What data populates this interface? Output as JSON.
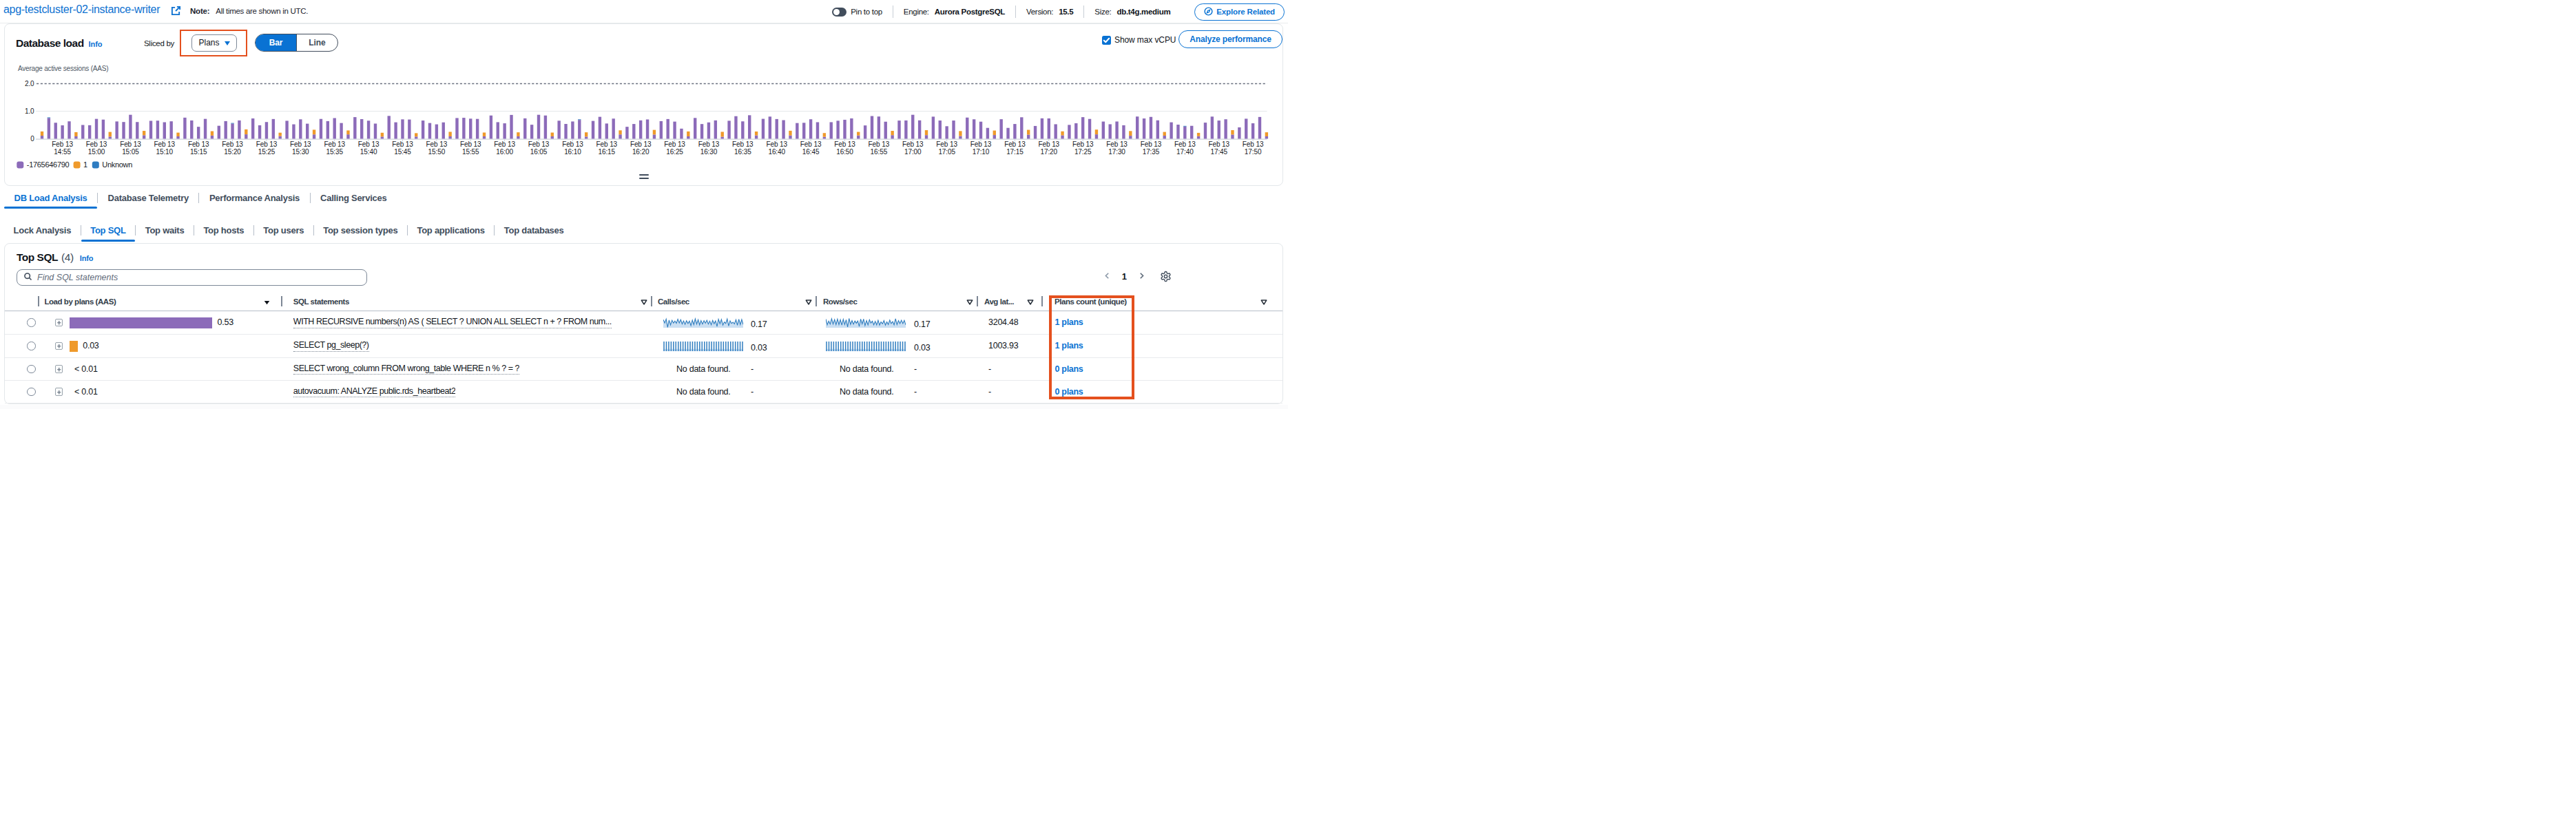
{
  "header": {
    "title": "apg-testcluster-02-instance-writer",
    "note_label": "Note:",
    "note_text": "All times are shown in UTC.",
    "pin_label": "Pin to top",
    "engine_label": "Engine:",
    "engine_value": "Aurora PostgreSQL",
    "version_label": "Version:",
    "version_value": "15.5",
    "size_label": "Size:",
    "size_value": "db.t4g.medium",
    "explore_button": "Explore Related"
  },
  "chart_section": {
    "title": "Database load",
    "info_label": "Info",
    "sliced_by_label": "Sliced by",
    "slice_value": "Plans",
    "bar_toggle": "Bar",
    "line_toggle": "Line",
    "show_max_vcpu_label": "Show max vCPU",
    "show_max_vcpu_checked": true,
    "analyze_button": "Analyze performance",
    "handle": "drag-resize"
  },
  "chart_data": {
    "type": "bar",
    "stacked": true,
    "title": "Average active sessions (AAS)",
    "ylabel": "Average active sessions (AAS)",
    "ylim": [
      0,
      2.0
    ],
    "y_ticks": [
      0,
      1.0,
      2.0
    ],
    "max_vcpu_line": 2.0,
    "x_start_time": "Feb 13 14:52",
    "x_interval_minutes": 1,
    "series": [
      {
        "name": "-1765646790",
        "color": "#8c6bb9",
        "key": "purple"
      },
      {
        "name": "1",
        "color": "#ef9a2b",
        "key": "orange"
      },
      {
        "name": "Unknown",
        "color": "#2e7cc1",
        "key": "blue"
      }
    ],
    "bars": [
      [
        0.111,
        0.154,
        0
      ],
      [
        0.754,
        0,
        0.022
      ],
      [
        0.581,
        0,
        0
      ],
      [
        0.487,
        0,
        0
      ],
      [
        0.632,
        0,
        0
      ],
      [
        0.087,
        0.151,
        0
      ],
      [
        0.5,
        0,
        0
      ],
      [
        0.491,
        0,
        0
      ],
      [
        0.721,
        0,
        0
      ],
      [
        0.695,
        0,
        0
      ],
      [
        0.078,
        0.169,
        0
      ],
      [
        0.628,
        0,
        0
      ],
      [
        0.608,
        0,
        0
      ],
      [
        0.87,
        0,
        0
      ],
      [
        0.607,
        0,
        0
      ],
      [
        0.129,
        0.157,
        0
      ],
      [
        0.651,
        0,
        0
      ],
      [
        0.657,
        0,
        0
      ],
      [
        0.6,
        0,
        0
      ],
      [
        0.633,
        0,
        0
      ],
      [
        0.087,
        0.135,
        0
      ],
      [
        0.766,
        0,
        0
      ],
      [
        0.664,
        0,
        0
      ],
      [
        0.434,
        0,
        0
      ],
      [
        0.721,
        0,
        0
      ],
      [
        0.117,
        0.158,
        0
      ],
      [
        0.471,
        0,
        0
      ],
      [
        0.64,
        0,
        0
      ],
      [
        0.55,
        0,
        0.022
      ],
      [
        0.665,
        0,
        0
      ],
      [
        0.16,
        0.18,
        0
      ],
      [
        0.737,
        0,
        0
      ],
      [
        0.488,
        0,
        0
      ],
      [
        0.607,
        0,
        0
      ],
      [
        0.716,
        0,
        0
      ],
      [
        0.096,
        0.124,
        0
      ],
      [
        0.652,
        0,
        0
      ],
      [
        0.524,
        0,
        0
      ],
      [
        0.705,
        0,
        0
      ],
      [
        0.547,
        0,
        0
      ],
      [
        0.156,
        0.171,
        0
      ],
      [
        0.719,
        0,
        0
      ],
      [
        0.64,
        0,
        0
      ],
      [
        0.75,
        0,
        0
      ],
      [
        0.571,
        0,
        0
      ],
      [
        0.158,
        0.144,
        0
      ],
      [
        0.785,
        0,
        0
      ],
      [
        0.712,
        0,
        0
      ],
      [
        0.656,
        0,
        0
      ],
      [
        0.55,
        0,
        0
      ],
      [
        0.078,
        0.14,
        0
      ],
      [
        0.829,
        0,
        0
      ],
      [
        0.597,
        0,
        0
      ],
      [
        0.704,
        0,
        0
      ],
      [
        0.698,
        0,
        0
      ],
      [
        0.079,
        0.124,
        0
      ],
      [
        0.661,
        0,
        0
      ],
      [
        0.571,
        0,
        0
      ],
      [
        0.523,
        0,
        0
      ],
      [
        0.594,
        0,
        0
      ],
      [
        0.087,
        0.164,
        0
      ],
      [
        0.752,
        0,
        0
      ],
      [
        0.761,
        0,
        0
      ],
      [
        0.729,
        0,
        0
      ],
      [
        0.72,
        0,
        0
      ],
      [
        0.089,
        0.136,
        0
      ],
      [
        0.844,
        0,
        0
      ],
      [
        0.602,
        0,
        0
      ],
      [
        0.56,
        0,
        0
      ],
      [
        0.865,
        0,
        0
      ],
      [
        0.089,
        0.144,
        0
      ],
      [
        0.74,
        0,
        0
      ],
      [
        0.509,
        0,
        0
      ],
      [
        0.87,
        0,
        0
      ],
      [
        0.844,
        0,
        0
      ],
      [
        0.089,
        0.135,
        0
      ],
      [
        0.655,
        0,
        0
      ],
      [
        0.538,
        0,
        0
      ],
      [
        0.627,
        0,
        0
      ],
      [
        0.683,
        0,
        0.022
      ],
      [
        0.078,
        0.155,
        0
      ],
      [
        0.647,
        0,
        0
      ],
      [
        0.796,
        0,
        0
      ],
      [
        0.553,
        0,
        0
      ],
      [
        0.731,
        0,
        0
      ],
      [
        0.156,
        0.149,
        0
      ],
      [
        0.434,
        0,
        0
      ],
      [
        0.536,
        0,
        0
      ],
      [
        0.667,
        0,
        0
      ],
      [
        0.701,
        0,
        0
      ],
      [
        0.152,
        0.169,
        0
      ],
      [
        0.64,
        0,
        0
      ],
      [
        0.715,
        0,
        0
      ],
      [
        0.622,
        0,
        0
      ],
      [
        0.367,
        0,
        0
      ],
      [
        0.088,
        0.177,
        0
      ],
      [
        0.755,
        0,
        0
      ],
      [
        0.534,
        0,
        0
      ],
      [
        0.593,
        0,
        0
      ],
      [
        0.666,
        0,
        0
      ],
      [
        0.073,
        0.178,
        0
      ],
      [
        0.653,
        0,
        0
      ],
      [
        0.819,
        0,
        0
      ],
      [
        0.631,
        0,
        0
      ],
      [
        0.854,
        0,
        0
      ],
      [
        0.124,
        0.138,
        0
      ],
      [
        0.723,
        0,
        0
      ],
      [
        0.804,
        0,
        0
      ],
      [
        0.715,
        0,
        0
      ],
      [
        0.675,
        0,
        0
      ],
      [
        0.12,
        0.171,
        0
      ],
      [
        0.57,
        0,
        0
      ],
      [
        0.579,
        0,
        0
      ],
      [
        0.707,
        0,
        0
      ],
      [
        0.601,
        0,
        0
      ],
      [
        0.071,
        0.136,
        0
      ],
      [
        0.602,
        0,
        0
      ],
      [
        0.654,
        0,
        0
      ],
      [
        0.689,
        0,
        0
      ],
      [
        0.739,
        0,
        0
      ],
      [
        0.121,
        0.128,
        0
      ],
      [
        0.483,
        0,
        0
      ],
      [
        0.824,
        0,
        0
      ],
      [
        0.807,
        0,
        0
      ],
      [
        0.619,
        0,
        0
      ],
      [
        0.132,
        0.155,
        0
      ],
      [
        0.66,
        0,
        0
      ],
      [
        0.664,
        0,
        0
      ],
      [
        0.87,
        0,
        0
      ],
      [
        0.668,
        0,
        0
      ],
      [
        0.133,
        0.178,
        0
      ],
      [
        0.802,
        0,
        0
      ],
      [
        0.662,
        0,
        0
      ],
      [
        0.455,
        0,
        0
      ],
      [
        0.661,
        0,
        0
      ],
      [
        0.099,
        0.18,
        0
      ],
      [
        0.769,
        0,
        0
      ],
      [
        0.706,
        0,
        0
      ],
      [
        0.62,
        0,
        0
      ],
      [
        0.394,
        0,
        0
      ],
      [
        0.136,
        0.162,
        0
      ],
      [
        0.709,
        0,
        0
      ],
      [
        0.394,
        0,
        0
      ],
      [
        0.536,
        0,
        0
      ],
      [
        0.78,
        0,
        0
      ],
      [
        0.151,
        0.172,
        0
      ],
      [
        0.464,
        0,
        0
      ],
      [
        0.741,
        0,
        0
      ],
      [
        0.738,
        0,
        0
      ],
      [
        0.527,
        0,
        0
      ],
      [
        0.126,
        0.143,
        0
      ],
      [
        0.503,
        0,
        0
      ],
      [
        0.562,
        0,
        0
      ],
      [
        0.784,
        0,
        0
      ],
      [
        0.719,
        0,
        0
      ],
      [
        0.159,
        0.173,
        0
      ],
      [
        0.624,
        0,
        0
      ],
      [
        0.527,
        0,
        0
      ],
      [
        0.626,
        0,
        0
      ],
      [
        0.489,
        0,
        0
      ],
      [
        0.11,
        0.17,
        0
      ],
      [
        0.806,
        0,
        0
      ],
      [
        0.736,
        0,
        0
      ],
      [
        0.793,
        0,
        0
      ],
      [
        0.669,
        0,
        0
      ],
      [
        0.113,
        0.134,
        0
      ],
      [
        0.597,
        0,
        0
      ],
      [
        0.512,
        0,
        0
      ],
      [
        0.445,
        0,
        0.022
      ],
      [
        0.469,
        0,
        0
      ],
      [
        0.093,
        0.121,
        0
      ],
      [
        0.585,
        0,
        0
      ],
      [
        0.804,
        0,
        0
      ],
      [
        0.661,
        0,
        0
      ],
      [
        0.707,
        0,
        0
      ],
      [
        0.152,
        0.16,
        0
      ],
      [
        0.413,
        0,
        0
      ],
      [
        0.727,
        0,
        0
      ],
      [
        0.561,
        0,
        0
      ],
      [
        0.791,
        0,
        0
      ],
      [
        0.088,
        0.146,
        0
      ]
    ],
    "x_labels": [
      {
        "i": 3,
        "l1": "Feb 13",
        "l2": "14:55"
      },
      {
        "i": 8,
        "l1": "Feb 13",
        "l2": "15:00"
      },
      {
        "i": 13,
        "l1": "Feb 13",
        "l2": "15:05"
      },
      {
        "i": 18,
        "l1": "Feb 13",
        "l2": "15:10"
      },
      {
        "i": 23,
        "l1": "Feb 13",
        "l2": "15:15"
      },
      {
        "i": 28,
        "l1": "Feb 13",
        "l2": "15:20"
      },
      {
        "i": 33,
        "l1": "Feb 13",
        "l2": "15:25"
      },
      {
        "i": 38,
        "l1": "Feb 13",
        "l2": "15:30"
      },
      {
        "i": 43,
        "l1": "Feb 13",
        "l2": "15:35"
      },
      {
        "i": 48,
        "l1": "Feb 13",
        "l2": "15:40"
      },
      {
        "i": 53,
        "l1": "Feb 13",
        "l2": "15:45"
      },
      {
        "i": 58,
        "l1": "Feb 13",
        "l2": "15:50"
      },
      {
        "i": 63,
        "l1": "Feb 13",
        "l2": "15:55"
      },
      {
        "i": 68,
        "l1": "Feb 13",
        "l2": "16:00"
      },
      {
        "i": 73,
        "l1": "Feb 13",
        "l2": "16:05"
      },
      {
        "i": 78,
        "l1": "Feb 13",
        "l2": "16:10"
      },
      {
        "i": 83,
        "l1": "Feb 13",
        "l2": "16:15"
      },
      {
        "i": 88,
        "l1": "Feb 13",
        "l2": "16:20"
      },
      {
        "i": 93,
        "l1": "Feb 13",
        "l2": "16:25"
      },
      {
        "i": 98,
        "l1": "Feb 13",
        "l2": "16:30"
      },
      {
        "i": 103,
        "l1": "Feb 13",
        "l2": "16:35"
      },
      {
        "i": 108,
        "l1": "Feb 13",
        "l2": "16:40"
      },
      {
        "i": 113,
        "l1": "Feb 13",
        "l2": "16:45"
      },
      {
        "i": 118,
        "l1": "Feb 13",
        "l2": "16:50"
      },
      {
        "i": 123,
        "l1": "Feb 13",
        "l2": "16:55"
      },
      {
        "i": 128,
        "l1": "Feb 13",
        "l2": "17:00"
      },
      {
        "i": 133,
        "l1": "Feb 13",
        "l2": "17:05"
      },
      {
        "i": 138,
        "l1": "Feb 13",
        "l2": "17:10"
      },
      {
        "i": 143,
        "l1": "Feb 13",
        "l2": "17:15"
      },
      {
        "i": 148,
        "l1": "Feb 13",
        "l2": "17:20"
      },
      {
        "i": 153,
        "l1": "Feb 13",
        "l2": "17:25"
      },
      {
        "i": 158,
        "l1": "Feb 13",
        "l2": "17:30"
      },
      {
        "i": 163,
        "l1": "Feb 13",
        "l2": "17:35"
      },
      {
        "i": 168,
        "l1": "Feb 13",
        "l2": "17:40"
      },
      {
        "i": 173,
        "l1": "Feb 13",
        "l2": "17:45"
      },
      {
        "i": 178,
        "l1": "Feb 13",
        "l2": "17:50"
      }
    ],
    "legend": [
      {
        "label": "-1765646790",
        "color": "#8c6bb9"
      },
      {
        "label": "1",
        "color": "#ef9a2b"
      },
      {
        "label": "Unknown",
        "color": "#2e7cc1"
      }
    ]
  },
  "tabs": [
    {
      "label": "DB Load Analysis",
      "active": true
    },
    {
      "label": "Database Telemetry",
      "active": false
    },
    {
      "label": "Performance Analysis",
      "active": false
    },
    {
      "label": "Calling Services",
      "active": false
    }
  ],
  "subtabs": [
    {
      "label": "Lock Analysis",
      "active": false
    },
    {
      "label": "Top SQL",
      "active": true
    },
    {
      "label": "Top waits",
      "active": false
    },
    {
      "label": "Top hosts",
      "active": false
    },
    {
      "label": "Top users",
      "active": false
    },
    {
      "label": "Top session types",
      "active": false
    },
    {
      "label": "Top applications",
      "active": false
    },
    {
      "label": "Top databases",
      "active": false
    }
  ],
  "table": {
    "title": "Top SQL",
    "count": "(4)",
    "info_label": "Info",
    "search_placeholder": "Find SQL statements",
    "pagination": {
      "page": "1"
    },
    "columns": [
      {
        "label": "Load by plans (AAS)",
        "sort": "desc"
      },
      {
        "label": "SQL statements",
        "filter": true
      },
      {
        "label": "Calls/sec",
        "filter": true
      },
      {
        "label": "Rows/sec",
        "filter": true
      },
      {
        "label": "Avg lat...",
        "filter": true
      },
      {
        "label": "Plans count (unique)",
        "filter": true
      }
    ],
    "rows": [
      {
        "load_value": "0.53",
        "load_frac": 0.53,
        "load_color": "#8c6bb9",
        "sql": "WITH RECURSIVE numbers(n) AS ( SELECT ? UNION ALL SELECT n + ? FROM num...",
        "calls": "0.17",
        "calls_spark": "jagged",
        "rows": "0.17",
        "rows_spark": "jagged",
        "avg_lat": "3204.48",
        "plans": "1 plans"
      },
      {
        "load_value": "0.03",
        "load_frac": 0.03,
        "load_color": "#ef9a2b",
        "sql": "SELECT pg_sleep(?)",
        "calls": "0.03",
        "calls_spark": "comb",
        "rows": "0.03",
        "rows_spark": "comb",
        "avg_lat": "1003.93",
        "plans": "1 plans"
      },
      {
        "load_value": "< 0.01",
        "load_frac": 0,
        "load_color": "",
        "sql": "SELECT wrong_column FROM wrong_table WHERE n % ? = ?",
        "calls": "No data found.",
        "calls_spark": "",
        "rows": "No data found.",
        "rows_spark": "",
        "calls_dash": "-",
        "rows_dash": "-",
        "avg_lat": "-",
        "plans": "0 plans"
      },
      {
        "load_value": "< 0.01",
        "load_frac": 0,
        "load_color": "",
        "sql": "autovacuum: ANALYZE public.rds_heartbeat2",
        "calls": "No data found.",
        "calls_spark": "",
        "rows": "No data found.",
        "rows_spark": "",
        "calls_dash": "-",
        "rows_dash": "-",
        "avg_lat": "-",
        "plans": "0 plans"
      }
    ],
    "sparkline_jagged": [
      0.87,
      0.51,
      0.93,
      0.05,
      0.83,
      0.3,
      0.81,
      0.5,
      0.72,
      0.48,
      0.92,
      0.51,
      0.87,
      0.41,
      0.74,
      0.36,
      0.76,
      0.46,
      0.72,
      0.24,
      0.82,
      0.33,
      0.96,
      0.39,
      0.87,
      0.3,
      0.77,
      0.39,
      0.76,
      0.49,
      0.81,
      0.39,
      0.72,
      0.32,
      0.8,
      0.44,
      0.74,
      0.13,
      0.91,
      0.44,
      0.89,
      0.28,
      0.62,
      0.47,
      0.95,
      0.19,
      0.75,
      0.47,
      0.59,
      0.41,
      0.87,
      0.27,
      0.92,
      0.34,
      0.88,
      0.35
    ],
    "sparkline_jagged2": [
      0.93,
      0.32,
      0.71,
      0.39,
      0.97,
      0.39,
      0.88,
      0.33,
      0.93,
      0.33,
      0.87,
      0.28,
      0.92,
      0.35,
      0.86,
      0.09,
      1.0,
      0.36,
      0.78,
      0.38,
      0.73,
      0.49,
      0.73,
      0.13,
      0.93,
      0.41,
      0.94,
      0.24,
      0.77,
      0.3,
      0.87,
      0.51,
      0.72,
      0.32,
      0.7,
      0.31,
      0.81,
      0.29,
      0.62,
      0.42,
      0.78,
      0.28,
      0.63,
      0.35,
      0.83,
      0.45,
      0.67,
      0.32,
      0.97,
      0.34,
      0.77,
      0.45,
      0.81,
      0.45,
      0.8,
      0.3
    ]
  },
  "annotations": {
    "color": "#e4501e",
    "boxes": [
      "sliced-by-dropdown",
      "plans-count-column"
    ]
  },
  "colors": {
    "accent": "#0972d3",
    "text": "#0f141a",
    "secondary": "#414d5c",
    "muted": "#5f6b7a",
    "border_light": "#e9ebed",
    "border_mid": "#b6bec9",
    "purple": "#8c6bb9",
    "orange": "#ef9a2b",
    "unknown_blue": "#2e7cc1",
    "spark_blue": "#2f7dbf",
    "annotation": "#e4501e"
  }
}
